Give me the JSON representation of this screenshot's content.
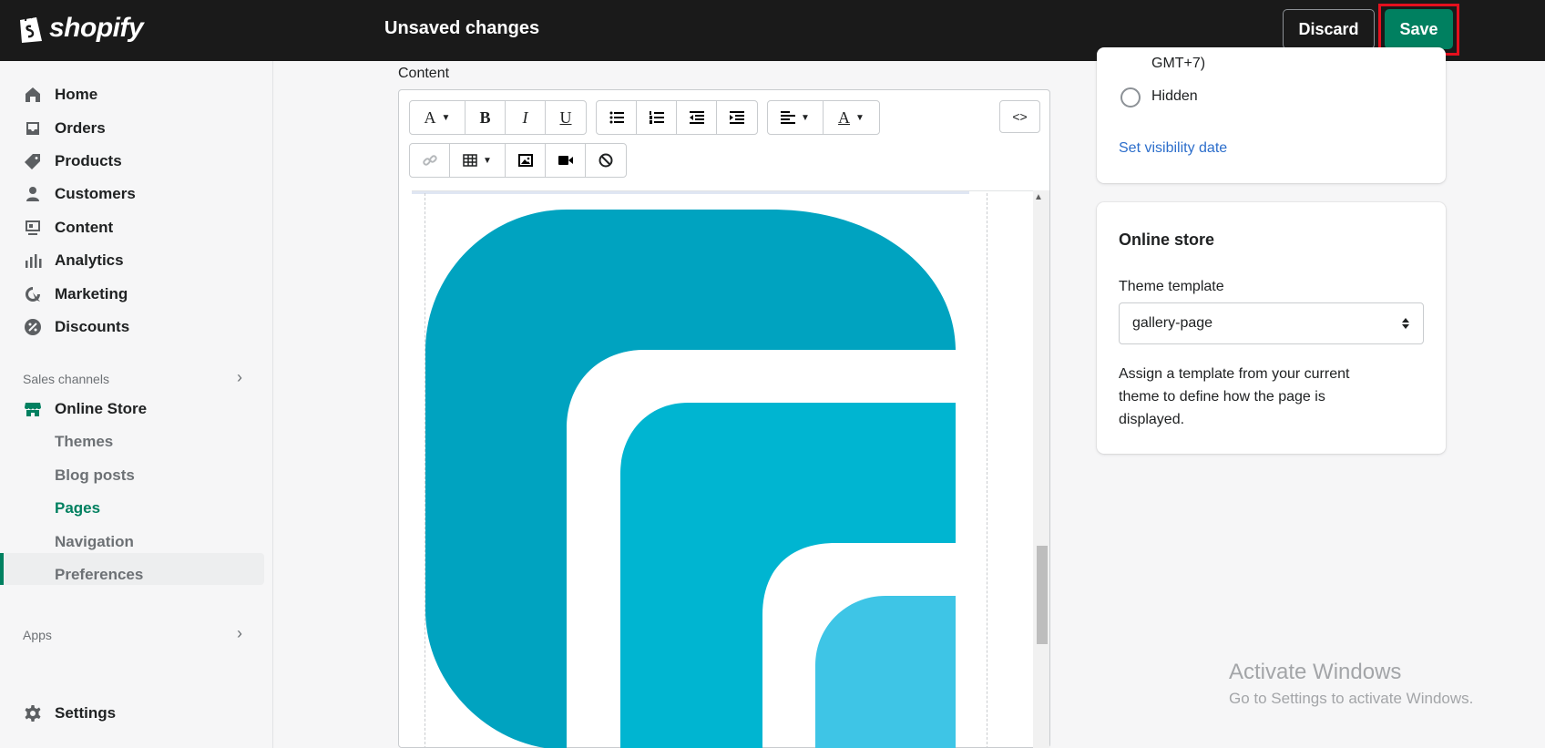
{
  "topbar": {
    "brand": "shopify",
    "status": "Unsaved changes",
    "discard_label": "Discard",
    "save_label": "Save"
  },
  "sidebar": {
    "items": [
      {
        "label": "Home",
        "icon": "home-icon"
      },
      {
        "label": "Orders",
        "icon": "orders-icon"
      },
      {
        "label": "Products",
        "icon": "tag-icon"
      },
      {
        "label": "Customers",
        "icon": "person-icon"
      },
      {
        "label": "Content",
        "icon": "content-icon"
      },
      {
        "label": "Analytics",
        "icon": "analytics-icon"
      },
      {
        "label": "Marketing",
        "icon": "marketing-icon"
      },
      {
        "label": "Discounts",
        "icon": "discount-icon"
      }
    ],
    "sales_channels_label": "Sales channels",
    "online_store_label": "Online Store",
    "sub_items": [
      "Themes",
      "Blog posts",
      "Pages",
      "Navigation",
      "Preferences"
    ],
    "active_sub_item": "Pages",
    "apps_label": "Apps",
    "settings_label": "Settings"
  },
  "editor": {
    "label": "Content",
    "html_button": "<>"
  },
  "visibility": {
    "partial_text": "GMT+7)",
    "hidden_label": "Hidden",
    "set_date_link": "Set visibility date"
  },
  "online_store": {
    "title": "Online store",
    "theme_template_label": "Theme template",
    "selected_template": "gallery-page",
    "help_lines": [
      "Assign a template from your current",
      "theme to define how the page is",
      "displayed."
    ]
  },
  "watermark": {
    "title": "Activate Windows",
    "subtitle": "Go to Settings to activate Windows."
  },
  "colors": {
    "topbar": "#1a1a1a",
    "save_green": "#008060",
    "highlight_red": "#e5101e",
    "link_blue": "#2c6ecb",
    "logo_dark": "#00a3c0",
    "logo_mid": "#00b5d1",
    "logo_light": "#3ec5e6"
  }
}
